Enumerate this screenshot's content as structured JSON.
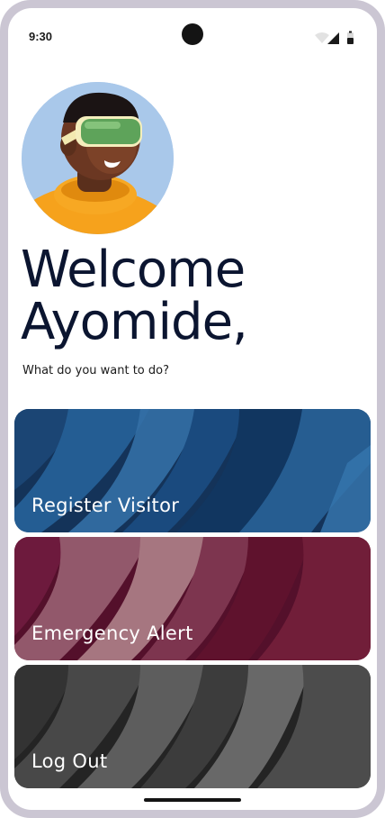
{
  "status_bar": {
    "time": "9:30",
    "icons": [
      "wifi-icon",
      "cellular-signal-icon",
      "battery-icon"
    ]
  },
  "avatar": {
    "icon": "vr-headset-user-avatar",
    "background_color": "#a9c8ea"
  },
  "welcome": {
    "line1": "Welcome",
    "line2": "Ayomide,",
    "subtitle": "What do you want to do?"
  },
  "actions": [
    {
      "label": "Register Visitor",
      "color": "#1d4a7a"
    },
    {
      "label": "Emergency Alert",
      "color": "#6e1734"
    },
    {
      "label": "Log Out",
      "color": "#3a3a3a"
    }
  ]
}
